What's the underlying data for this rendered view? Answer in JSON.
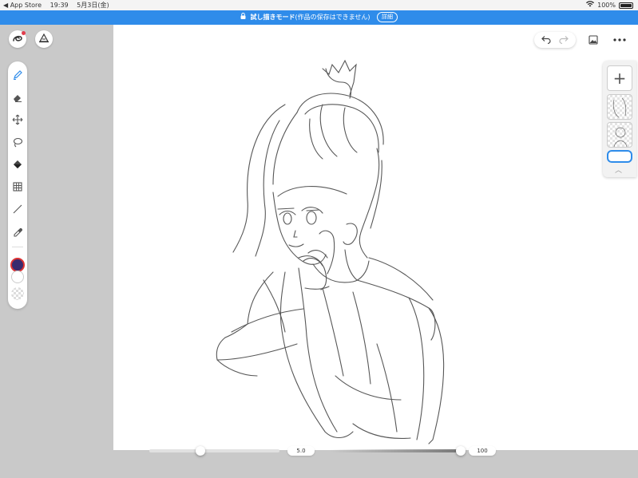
{
  "status_bar": {
    "back_app": "◀ App Store",
    "time": "19:39",
    "date": "5月3日(金)",
    "battery": "100%"
  },
  "banner": {
    "mode": "試し描きモード",
    "note": "(作品の保存はできません)",
    "detail_label": "詳細"
  },
  "toolbar": {
    "tools": [
      "pen-icon",
      "eraser-icon",
      "move-icon",
      "lasso-icon",
      "fill-icon",
      "filter-icon",
      "line-icon",
      "eyedropper-icon"
    ],
    "main_color": "#3a2a6e",
    "main_color_ring": "#dd3333",
    "sub_color": "#ffffff"
  },
  "layers": {
    "add_label": "+"
  },
  "brush": {
    "size": "5.0",
    "opacity": "100",
    "size_fraction": 0.39,
    "opacity_fraction": 1.0
  },
  "accent": "#2f8cea"
}
